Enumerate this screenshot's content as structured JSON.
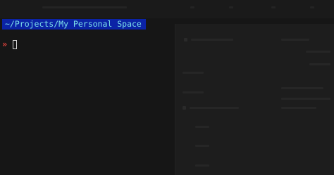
{
  "terminal": {
    "path": "~/Projects/My Personal Space",
    "prompt_symbol": "»",
    "input_value": ""
  },
  "colors": {
    "background": "#161616",
    "path_background": "#0b23a6",
    "path_text": "#7de0ea",
    "prompt_symbol": "#e0433d",
    "cursor": "#d8d8d8"
  }
}
